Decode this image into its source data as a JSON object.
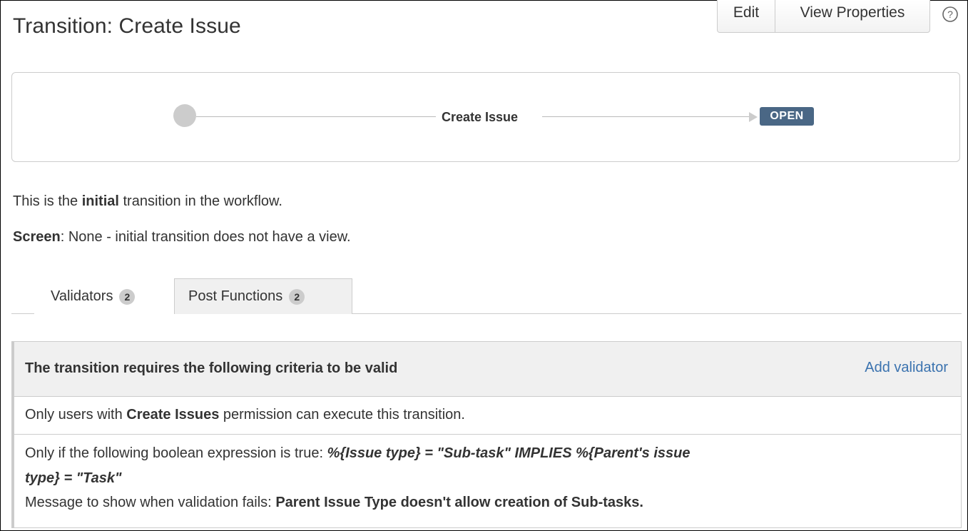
{
  "header": {
    "title": "Transition: Create Issue",
    "edit_label": "Edit",
    "view_properties_label": "View Properties",
    "help_icon": "question-circle-icon"
  },
  "diagram": {
    "transition_name": "Create Issue",
    "target_status": "OPEN",
    "status_color": "#4a6785"
  },
  "info": {
    "line1_prefix": "This is the ",
    "line1_bold": "initial",
    "line1_suffix": " transition in the workflow.",
    "screen_label": "Screen",
    "screen_value": ": None - initial transition does not have a view."
  },
  "tabs": [
    {
      "label": "Validators",
      "count": "2",
      "active": true
    },
    {
      "label": "Post Functions",
      "count": "2",
      "active": false
    }
  ],
  "validators": {
    "header": "The transition requires the following criteria to be valid",
    "add_link": "Add validator",
    "link_color": "#3b73af",
    "rule1": {
      "prefix": "Only users with ",
      "bold": "Create Issues",
      "suffix": " permission can execute this transition."
    },
    "rule2": {
      "prefix": "Only if the following boolean expression is true: ",
      "expression_line1": "%{Issue type} = \"Sub-task\" IMPLIES %{Parent's issue",
      "expression_line2": "type} = \"Task\"",
      "message_prefix": "Message to show when validation fails: ",
      "message_bold": "Parent Issue Type doesn't allow creation of Sub-tasks."
    }
  }
}
